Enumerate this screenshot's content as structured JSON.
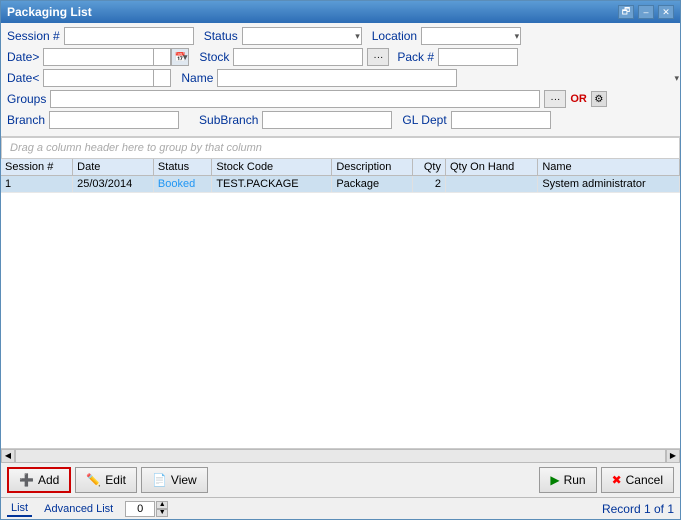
{
  "window": {
    "title": "Packaging List"
  },
  "titlebar": {
    "restore_label": "🗗",
    "minimize_label": "–",
    "close_label": "✕"
  },
  "form": {
    "session_label": "Session #",
    "status_label": "Status",
    "location_label": "Location",
    "date_gt_label": "Date>",
    "stock_label": "Stock",
    "pack_label": "Pack #",
    "date_lt_label": "Date<",
    "name_label": "Name",
    "groups_label": "Groups",
    "branch_label": "Branch",
    "subbranch_label": "SubBranch",
    "gldept_label": "GL Dept",
    "or_label": "OR",
    "dots_label": "···"
  },
  "drag_hint": "Drag a column header here to group by that column",
  "table": {
    "columns": [
      {
        "key": "session",
        "label": "Session #"
      },
      {
        "key": "date",
        "label": "Date"
      },
      {
        "key": "status",
        "label": "Status"
      },
      {
        "key": "stock_code",
        "label": "Stock Code"
      },
      {
        "key": "description",
        "label": "Description"
      },
      {
        "key": "qty",
        "label": "Qty"
      },
      {
        "key": "qty_on_hand",
        "label": "Qty On Hand"
      },
      {
        "key": "name",
        "label": "Name"
      }
    ],
    "rows": [
      {
        "session": "1",
        "date": "25/03/2014",
        "status": "Booked",
        "stock_code": "TEST.PACKAGE",
        "description": "Package",
        "qty": "2",
        "qty_on_hand": "",
        "name": "System administrator"
      }
    ]
  },
  "buttons": {
    "add": "Add",
    "edit": "Edit",
    "view": "View",
    "run": "Run",
    "cancel": "Cancel"
  },
  "statusbar": {
    "list_tab": "List",
    "advanced_tab": "Advanced List",
    "spinner_value": "0",
    "record_info": "Record 1 of 1"
  }
}
